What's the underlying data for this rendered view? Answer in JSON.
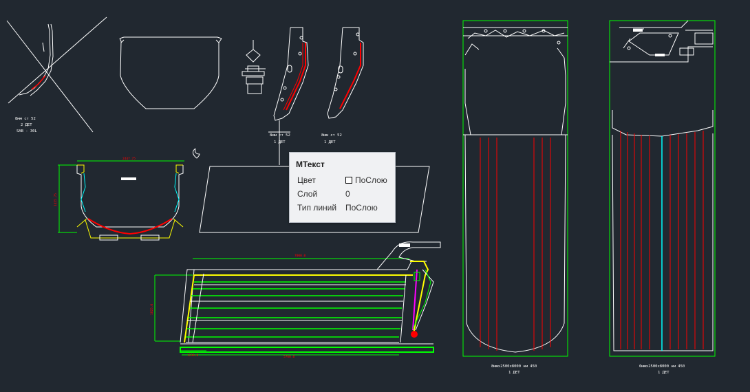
{
  "drawing": {
    "labels": {
      "part_a_line1": "8мм ст 52",
      "part_a_line2": "2 ДЕТ",
      "part_a_line3": "SAB - 30L",
      "part_b_line1": "8мм ст 52",
      "part_b_line2": "1 ДЕТ",
      "part_c_line1": "8мм ст 52",
      "part_c_line2": "1 ДЕТ",
      "panel_left_line1": "8ммх2500х8000 нм 450",
      "panel_left_line2": "1 ДЕТ",
      "panel_right_line1": "6ммх2500х8000 нм 450",
      "panel_right_line2": "1 ДЕТ",
      "dim_top_width": "2447.75",
      "dim_left_height": "1455.75",
      "dim_body_top": "7000.0",
      "dim_body_height": "1825.0",
      "dim_body_bottom_left": "1230.0",
      "dim_body_bottom": "5768.0"
    }
  },
  "tooltip": {
    "title": "МТекст",
    "rows": [
      {
        "label": "Цвет",
        "value": "ПоСлою"
      },
      {
        "label": "Слой",
        "value": "0"
      },
      {
        "label": "Тип линий",
        "value": "ПоСлою"
      }
    ]
  },
  "colors": {
    "background": "#212830",
    "line_white": "#ffffff",
    "line_green": "#00ff00",
    "line_red": "#ff0000",
    "line_yellow": "#ffff00",
    "line_cyan": "#00ffff",
    "line_magenta": "#ff00ff"
  }
}
